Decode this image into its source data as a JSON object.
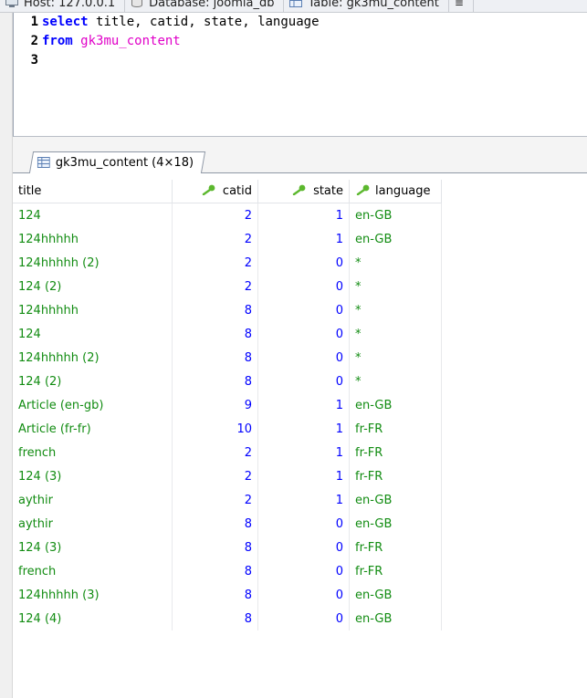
{
  "colors": {
    "keyword": "#0000ff",
    "table_name": "#e000c8",
    "text_value": "#128c12",
    "number_value": "#0000ff",
    "key_icon": "#5cb82e"
  },
  "top_tabs": [
    {
      "label": "Host: 127.0.0.1",
      "icon": "server-icon"
    },
    {
      "label": "Database: joomla_db",
      "icon": "database-icon"
    },
    {
      "label": "Table: gk3mu_content",
      "icon": "table-icon"
    }
  ],
  "editor": {
    "lines": [
      {
        "num": "1",
        "kw": "select",
        "cols": [
          "title",
          "catid",
          "state",
          "language"
        ]
      },
      {
        "num": "2",
        "kw": "from",
        "table": "gk3mu_content"
      },
      {
        "num": "3"
      }
    ]
  },
  "result_tab": {
    "label": "gk3mu_content (4×18)",
    "icon": "grid-icon"
  },
  "grid": {
    "columns": [
      {
        "label": "title",
        "key": false
      },
      {
        "label": "catid",
        "key": true
      },
      {
        "label": "state",
        "key": true
      },
      {
        "label": "language",
        "key": true
      }
    ],
    "rows": [
      {
        "title": "124",
        "catid": "2",
        "state": "1",
        "language": "en-GB"
      },
      {
        "title": "124hhhhh",
        "catid": "2",
        "state": "1",
        "language": "en-GB"
      },
      {
        "title": "124hhhhh (2)",
        "catid": "2",
        "state": "0",
        "language": "*"
      },
      {
        "title": "124 (2)",
        "catid": "2",
        "state": "0",
        "language": "*"
      },
      {
        "title": "124hhhhh",
        "catid": "8",
        "state": "0",
        "language": "*"
      },
      {
        "title": "124",
        "catid": "8",
        "state": "0",
        "language": "*"
      },
      {
        "title": "124hhhhh (2)",
        "catid": "8",
        "state": "0",
        "language": "*"
      },
      {
        "title": "124 (2)",
        "catid": "8",
        "state": "0",
        "language": "*"
      },
      {
        "title": "Article (en-gb)",
        "catid": "9",
        "state": "1",
        "language": "en-GB"
      },
      {
        "title": "Article (fr-fr)",
        "catid": "10",
        "state": "1",
        "language": "fr-FR"
      },
      {
        "title": "french",
        "catid": "2",
        "state": "1",
        "language": "fr-FR"
      },
      {
        "title": "124 (3)",
        "catid": "2",
        "state": "1",
        "language": "fr-FR"
      },
      {
        "title": "aythir",
        "catid": "2",
        "state": "1",
        "language": "en-GB"
      },
      {
        "title": "aythir",
        "catid": "8",
        "state": "0",
        "language": "en-GB"
      },
      {
        "title": "124 (3)",
        "catid": "8",
        "state": "0",
        "language": "fr-FR"
      },
      {
        "title": "french",
        "catid": "8",
        "state": "0",
        "language": "fr-FR"
      },
      {
        "title": "124hhhhh (3)",
        "catid": "8",
        "state": "0",
        "language": "en-GB"
      },
      {
        "title": "124 (4)",
        "catid": "8",
        "state": "0",
        "language": "en-GB"
      }
    ]
  }
}
